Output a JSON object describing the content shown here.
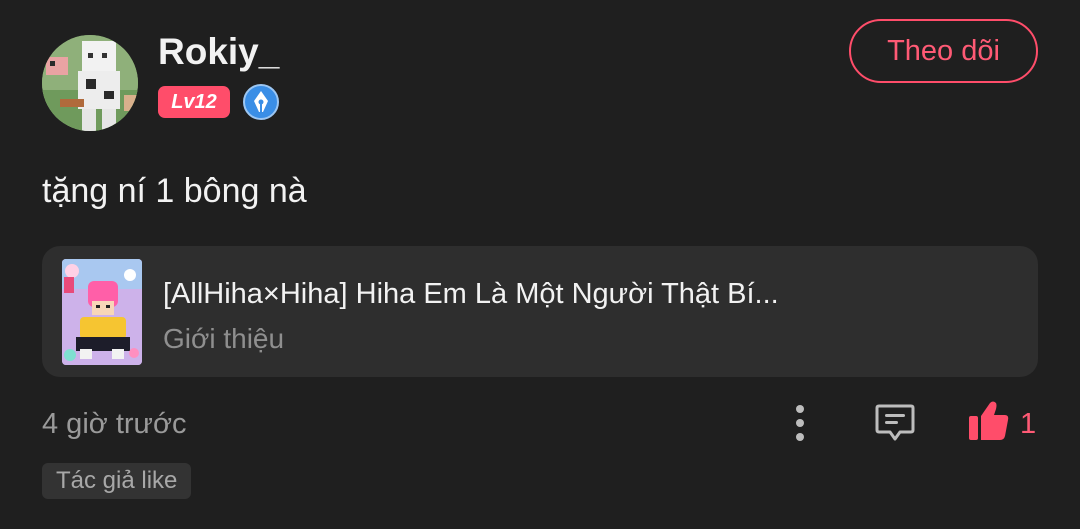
{
  "post": {
    "username": "Rokiy_",
    "level": "Lv12",
    "follow_label": "Theo dõi",
    "content": "tặng ní 1 bông nà",
    "timestamp": "4 giờ trước",
    "like_count": "1",
    "author_tag": "Tác giả like"
  },
  "story": {
    "title": "[AllHiha×Hiha] Hiha Em Là Một Người Thật Bí...",
    "subtitle": "Giới thiệu"
  },
  "icons": {
    "verified": "verified-pen-badge-icon",
    "more": "more-vertical-icon",
    "comment": "comment-icon",
    "like": "thumbs-up-icon"
  },
  "colors": {
    "accent": "#ff4d6a",
    "background": "#1f1f1f",
    "card": "#2e2e2e",
    "verified_blue": "#3a8ee6"
  }
}
